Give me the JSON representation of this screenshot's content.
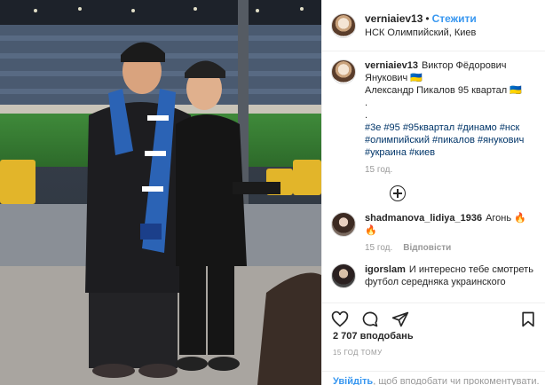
{
  "post": {
    "username": "verniaiev13",
    "dot": "•",
    "follow_label": "Стежити",
    "location": "НСК Олимпийский, Киев"
  },
  "caption": {
    "username": "verniaiev13",
    "line1": "Виктор Фёдорович Янукович 🇺🇦",
    "line2": "Александр Пикалов 95 квартал 🇺🇦",
    "line3": ".",
    "line4": ".",
    "hashtags": "#3е #95 #95квартал #динамо #нск #олимпийский #пикалов #янукович #украина #киев",
    "time": "15 год."
  },
  "comments": [
    {
      "username": "shadmanova_lidiya_1936",
      "text": "Агонь 🔥🔥",
      "time": "15 год.",
      "reply_label": "Відповісти"
    },
    {
      "username": "igorslam",
      "text": "И интересно тебе смотреть футбол середняка украинского",
      "time": "",
      "reply_label": ""
    }
  ],
  "actions": {
    "like_icon": "heart-icon",
    "comment_icon": "comment-icon",
    "share_icon": "share-icon",
    "save_icon": "bookmark-icon"
  },
  "likes": "2 707 вподобань",
  "date": "15 ГОД ТОМУ",
  "login_prompt": {
    "link": "Увійдіть",
    "text": ", щоб вподобати чи прокоментувати."
  },
  "colors": {
    "accent": "#3897f0",
    "hashtag": "#003569",
    "muted": "#999999"
  }
}
